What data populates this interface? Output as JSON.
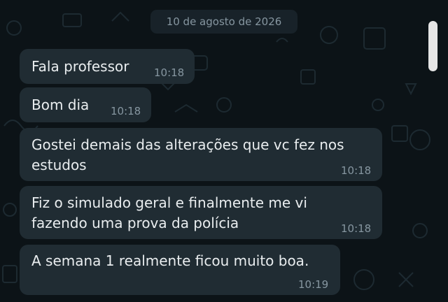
{
  "date_label": "10 de agosto de 2026",
  "messages": [
    {
      "lines": [
        "Fala professor"
      ],
      "time": "10:18"
    },
    {
      "lines": [
        "Bom dia"
      ],
      "time": "10:18"
    },
    {
      "lines": [
        "Gostei demais das alterações que vc fez nos",
        "estudos"
      ],
      "time": "10:18"
    },
    {
      "lines": [
        "Fiz o simulado geral e finalmente me vi",
        "fazendo uma prova da polícia"
      ],
      "time": "10:18"
    },
    {
      "lines": [
        "A semana 1 realmente ficou muito boa."
      ],
      "time": "10:19"
    }
  ],
  "colors": {
    "background": "#0c1317",
    "bubble": "#202c33",
    "text": "#e9edef",
    "meta": "#8696a0"
  }
}
